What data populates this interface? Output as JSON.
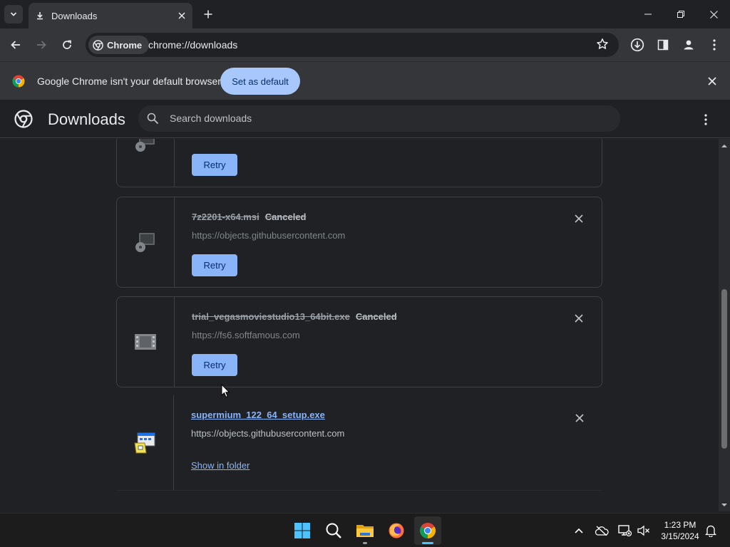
{
  "window": {
    "tab_title": "Downloads"
  },
  "toolbar": {
    "chip_label": "Chrome",
    "url": "chrome://downloads"
  },
  "infobar": {
    "message": "Google Chrome isn't your default browser",
    "button_label": "Set as default"
  },
  "downloads_page": {
    "title": "Downloads",
    "search_placeholder": "Search downloads",
    "items": [
      {
        "filename": "",
        "status": "",
        "url": "",
        "action_label": "Retry",
        "state": "canceled"
      },
      {
        "filename": "7z2201-x64.msi",
        "status": "Canceled",
        "url": "https://objects.githubusercontent.com",
        "action_label": "Retry",
        "state": "canceled"
      },
      {
        "filename": "trial_vegasmoviestudio13_64bit.exe",
        "status": "Canceled",
        "url": "https://fs6.softfamous.com",
        "action_label": "Retry",
        "state": "canceled"
      },
      {
        "filename": "supermium_122_64_setup.exe",
        "status": "",
        "url": "https://objects.githubusercontent.com",
        "action_label": "Show in folder",
        "state": "complete"
      }
    ]
  },
  "taskbar": {
    "apps": [
      "start-icon",
      "search-icon",
      "file-explorer-icon",
      "firefox-icon",
      "chrome-icon"
    ],
    "time": "1:23 PM",
    "date": "3/15/2024"
  },
  "colors": {
    "accent": "#8ab4f8",
    "infobar_button": "#a8c7fa",
    "background": "#202124"
  }
}
